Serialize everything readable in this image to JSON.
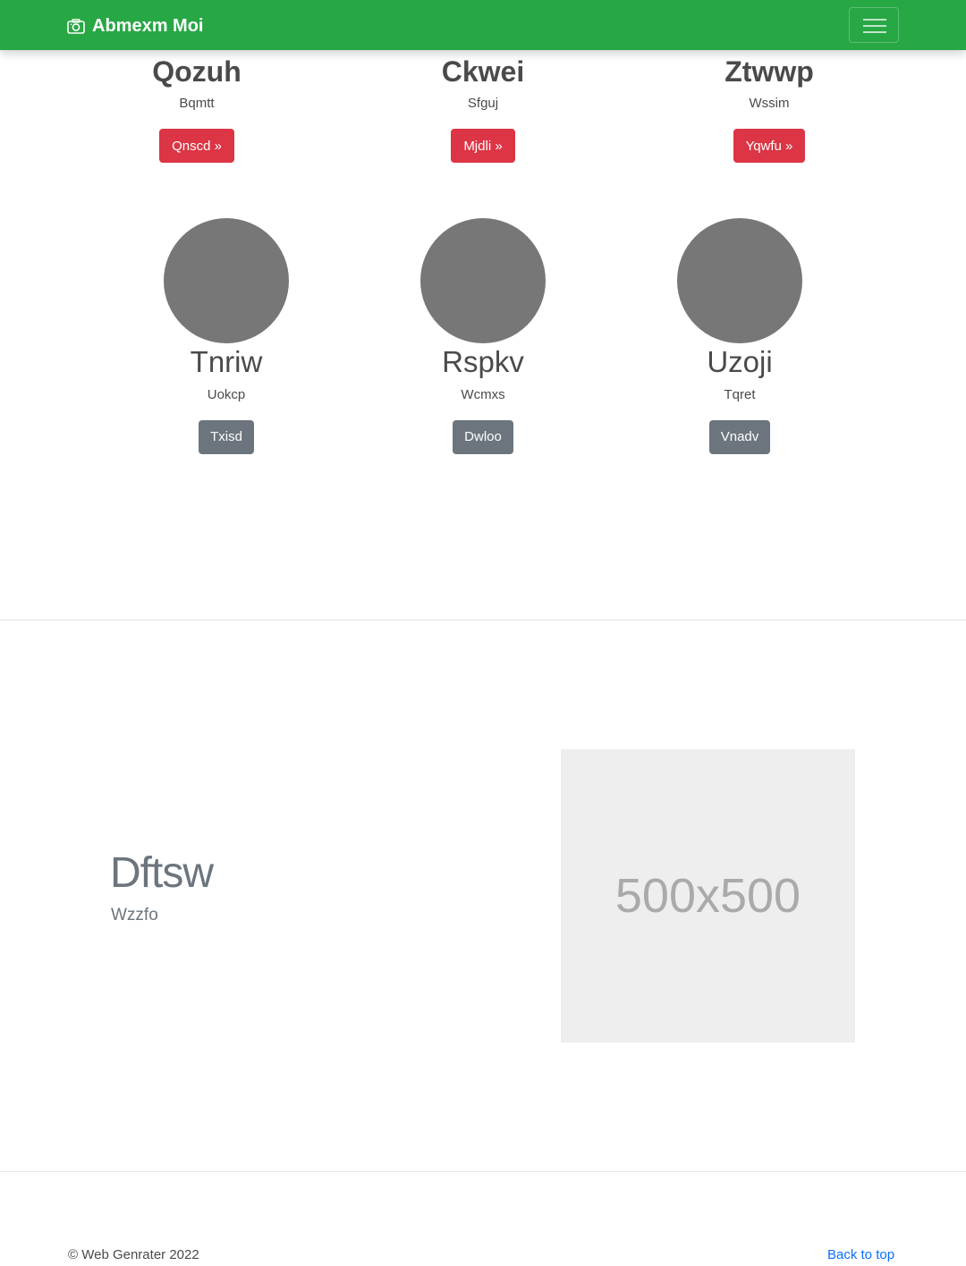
{
  "navbar": {
    "brand": "Abmexm Moi",
    "brand_icon": "camera-icon",
    "toggler_icon": "hamburger-icon"
  },
  "top_cards": [
    {
      "title": "Qozuh",
      "text": "Bqmtt",
      "button": "Qnscd »"
    },
    {
      "title": "Ckwei",
      "text": "Sfguj",
      "button": "Mjdli »"
    },
    {
      "title": "Ztwwp",
      "text": "Wssim",
      "button": "Yqwfu »"
    }
  ],
  "avatar_cards": [
    {
      "title": "Tnriw",
      "text": "Uokcp",
      "button": "Txisd"
    },
    {
      "title": "Rspkv",
      "text": "Wcmxs",
      "button": "Dwloo"
    },
    {
      "title": "Uzoji",
      "text": "Tqret",
      "button": "Vnadv"
    }
  ],
  "feature": {
    "title": "Dftsw",
    "subtitle": "Wzzfo",
    "image_label": "500x500"
  },
  "footer": {
    "copyright": "© Web Genrater 2022",
    "back_to_top": "Back to top"
  },
  "colors": {
    "navbar": "#28a745",
    "danger": "#dc3545",
    "secondary": "#6c757d",
    "avatar": "#777777",
    "link": "#0d6efd"
  }
}
